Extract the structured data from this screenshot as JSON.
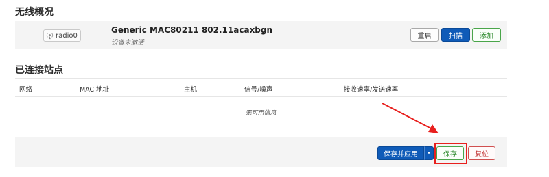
{
  "sections": {
    "wireless_overview": "无线概况",
    "connected_stations": "已连接站点"
  },
  "radio": {
    "badge_label": "radio0",
    "device_name": "Generic MAC80211 802.11acaxbgn",
    "status": "设备未激活",
    "buttons": {
      "restart": "重启",
      "scan": "扫描",
      "add": "添加"
    }
  },
  "stations_table": {
    "columns": [
      "网络",
      "MAC 地址",
      "主机",
      "信号/噪声",
      "接收速率/发送速率"
    ],
    "empty_message": "无可用信息"
  },
  "footer": {
    "save_apply": "保存并应用",
    "dropdown_caret": "▾",
    "save": "保存",
    "reset": "复位"
  },
  "colors": {
    "primary": "#0f5bb8",
    "positive": "#2e8a2e",
    "negative": "#c13030",
    "annotation": "#e8201e"
  },
  "icons": {
    "radio": "wireless-radio-icon"
  }
}
